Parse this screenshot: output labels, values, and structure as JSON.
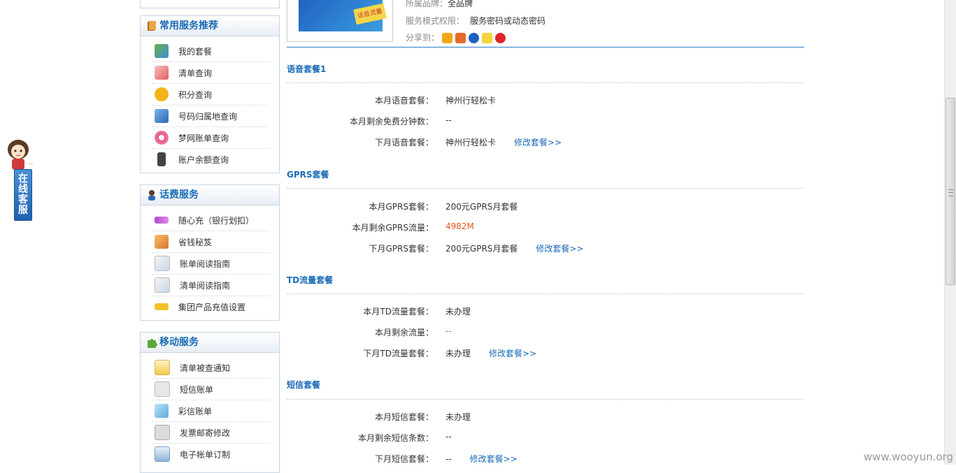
{
  "customer_service": {
    "label": "在线客服"
  },
  "sidebar": {
    "sections": [
      {
        "title": "常用服务推荐",
        "items": [
          "我的套餐",
          "清单查询",
          "积分查询",
          "号码归属地查询",
          "梦网账单查询",
          "账户余额查询"
        ]
      },
      {
        "title": "话费服务",
        "items": [
          "随心充（银行划扣）",
          "省钱秘笈",
          "账单阅读指南",
          "清单阅读指南",
          "集团产品充值设置"
        ]
      },
      {
        "title": "移动服务",
        "items": [
          "清单被查通知",
          "短信账单",
          "彩信账单",
          "发票邮寄修改",
          "电子帐单订制"
        ]
      }
    ]
  },
  "product": {
    "image_tag": "话音流量",
    "brand_label": "所属品牌：",
    "brand_value": "全品牌",
    "perm_label": "服务模式权限：",
    "perm_value": "服务密码或动态密码",
    "share_label": "分享到："
  },
  "sections": [
    {
      "title": "语音套餐1",
      "rows": [
        {
          "label": "本月语音套餐：",
          "value": "神州行轻松卡"
        },
        {
          "label": "本月剩余免费分钟数：",
          "value": "--"
        },
        {
          "label": "下月语音套餐：",
          "value": "神州行轻松卡",
          "link": "修改套餐>>"
        }
      ]
    },
    {
      "title": "GPRS套餐",
      "rows": [
        {
          "label": "本月GPRS套餐：",
          "value": "200元GPRS月套餐"
        },
        {
          "label": "本月剩余GPRS流量：",
          "value": "4982M",
          "highlight": true
        },
        {
          "label": "下月GPRS套餐：",
          "value": "200元GPRS月套餐",
          "link": "修改套餐>>"
        }
      ]
    },
    {
      "title": "TD流量套餐",
      "rows": [
        {
          "label": "本月TD流量套餐：",
          "value": "未办理"
        },
        {
          "label": "本月剩余流量：",
          "value": "--",
          "highlight": true
        },
        {
          "label": "下月TD流量套餐：",
          "value": "未办理",
          "link": "修改套餐>>"
        }
      ]
    },
    {
      "title": "短信套餐",
      "rows": [
        {
          "label": "本月短信套餐：",
          "value": "未办理"
        },
        {
          "label": "本月剩余短信条数：",
          "value": "--"
        },
        {
          "label": "下月短信套餐：",
          "value": "--",
          "link": "修改套餐>>"
        }
      ]
    }
  ],
  "watermark": "www.wooyun.org",
  "colors": {
    "accent": "#1a6bb5",
    "highlight": "#e0581c",
    "border": "#c8d4e2"
  }
}
